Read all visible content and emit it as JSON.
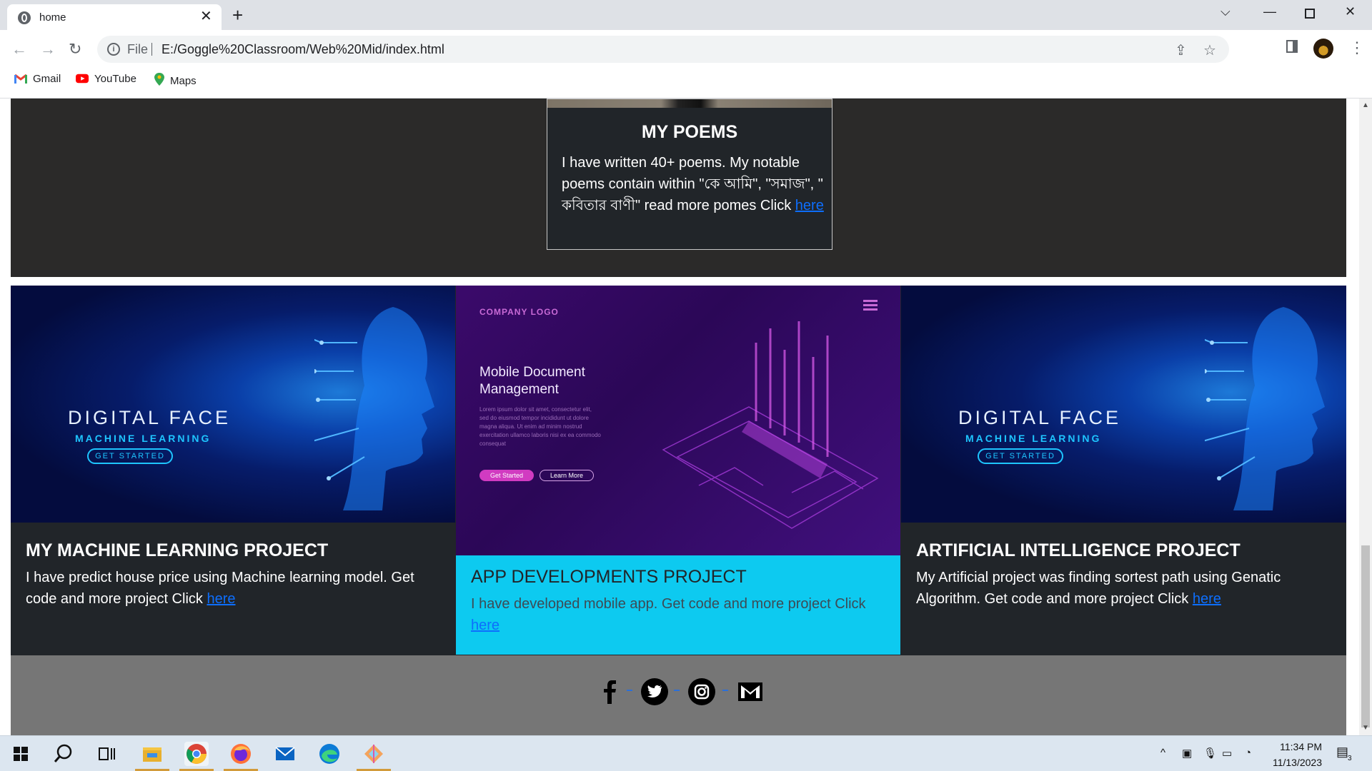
{
  "browser": {
    "tab_title": "home",
    "tab_close": "✕",
    "new_tab": "+",
    "scheme_label": "File",
    "url": "E:/Goggle%20Classroom/Web%20Mid/index.html",
    "bookmarks": [
      "Gmail",
      "YouTube",
      "Maps"
    ]
  },
  "page": {
    "poem_card": {
      "title": "MY POEMS",
      "text": "I have written 40+ poems. My notable poems contain within \"কে আমি\", \"সমাজ\", \" কবিতার বাণী\" read more pomes Click ",
      "link": "here"
    },
    "projects": [
      {
        "image": {
          "title": "DIGITAL FACE",
          "subtitle": "MACHINE LEARNING",
          "button": "GET STARTED"
        },
        "title": "MY MACHINE LEARNING PROJECT",
        "text": "I have predict house price using Machine learning model. Get code and more project Click ",
        "link": "here"
      },
      {
        "image": {
          "logo": "COMPANY LOGO",
          "title": "Mobile Document Management",
          "body": "Lorem ipsum dolor sit amet, consectetur elit, sed do eiusmod tempor incididunt ut dolore magna aliqua. Ut enim ad minim nostrud exercitation ullamco laboris nisi ex ea commodo consequat",
          "button1": "Get Started",
          "button2": "Learn More"
        },
        "title": "APP DEVELOPMENTS PROJECT",
        "text": "I have developed mobile app. Get code and more project Click ",
        "link": "here"
      },
      {
        "image": {
          "title": "DIGITAL FACE",
          "subtitle": "MACHINE LEARNING",
          "button": "GET STARTED"
        },
        "title": "ARTIFICIAL INTELLIGENCE PROJECT",
        "text": "My Artificial project was finding sortest path using Genatic Algorithm. Get code and more project Click ",
        "link": "here"
      }
    ],
    "footer_icons": [
      "facebook-icon",
      "twitter-icon",
      "instagram-icon",
      "mail-icon"
    ]
  },
  "taskbar": {
    "time": "11:34 PM",
    "date": "11/13/2023",
    "notifications": "3"
  }
}
